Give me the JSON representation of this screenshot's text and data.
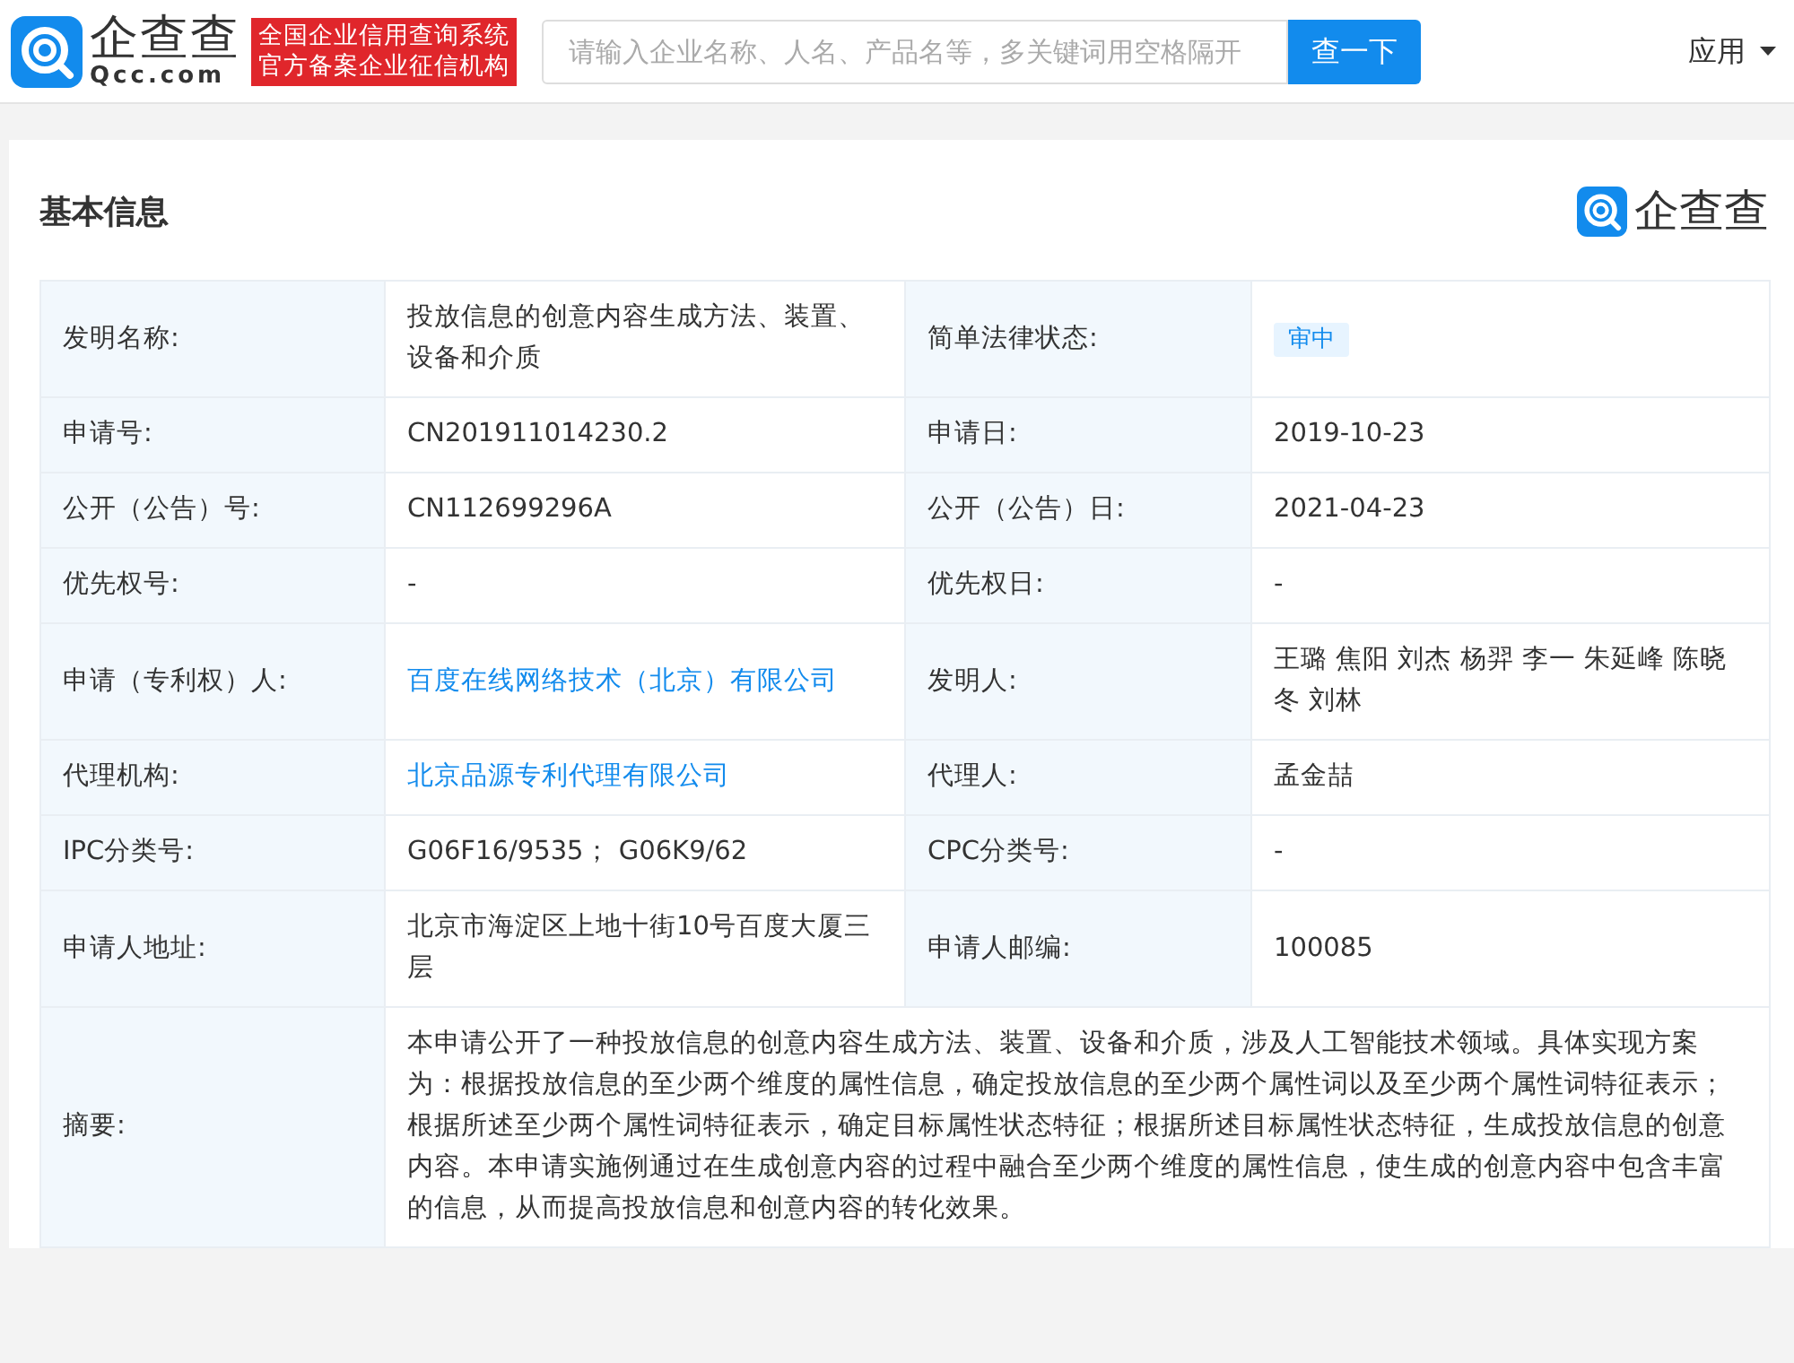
{
  "header": {
    "logo": {
      "name": "企查查",
      "domain": "Qcc.com"
    },
    "slogan": [
      "全国企业信用查询系统",
      "官方备案企业征信机构"
    ],
    "search": {
      "placeholder": "请输入企业名称、人名、产品名等，多关键词用空格隔开"
    },
    "search_button": "查一下",
    "menu": "应用"
  },
  "section": {
    "title": "基本信息",
    "brand": "企查查"
  },
  "rows": [
    {
      "fields": [
        {
          "label": "发明名称:",
          "kind": "text",
          "value": "投放信息的创意内容生成方法、装置、设备和介质"
        },
        {
          "label": "简单法律状态:",
          "kind": "badge",
          "value": "审中"
        }
      ]
    },
    {
      "fields": [
        {
          "label": "申请号:",
          "kind": "text",
          "value": "CN201911014230.2"
        },
        {
          "label": "申请日:",
          "kind": "text",
          "value": "2019-10-23"
        }
      ]
    },
    {
      "fields": [
        {
          "label": "公开（公告）号:",
          "kind": "text",
          "value": "CN112699296A"
        },
        {
          "label": "公开（公告）日:",
          "kind": "text",
          "value": "2021-04-23"
        }
      ]
    },
    {
      "fields": [
        {
          "label": "优先权号:",
          "kind": "text",
          "value": "-"
        },
        {
          "label": "优先权日:",
          "kind": "text",
          "value": "-"
        }
      ]
    },
    {
      "fields": [
        {
          "label": "申请（专利权）人:",
          "kind": "link",
          "value": "百度在线网络技术（北京）有限公司"
        },
        {
          "label": "发明人:",
          "kind": "text",
          "value": "王璐 焦阳 刘杰 杨羿 李一 朱延峰 陈晓冬 刘林"
        }
      ]
    },
    {
      "fields": [
        {
          "label": "代理机构:",
          "kind": "link",
          "value": "北京品源专利代理有限公司"
        },
        {
          "label": "代理人:",
          "kind": "text",
          "value": "孟金喆"
        }
      ]
    },
    {
      "fields": [
        {
          "label": "IPC分类号:",
          "kind": "text",
          "value": "G06F16/9535； G06K9/62"
        },
        {
          "label": "CPC分类号:",
          "kind": "text",
          "value": "-"
        }
      ]
    },
    {
      "fields": [
        {
          "label": "申请人地址:",
          "kind": "text",
          "value": "北京市海淀区上地十街10号百度大厦三层"
        },
        {
          "label": "申请人邮编:",
          "kind": "text",
          "value": "100085"
        }
      ]
    },
    {
      "fields": [
        {
          "label": "摘要:",
          "kind": "text",
          "value": "本申请公开了一种投放信息的创意内容生成方法、装置、设备和介质，涉及人工智能技术领域。具体实现方案为：根据投放信息的至少两个维度的属性信息，确定投放信息的至少两个属性词以及至少两个属性词特征表示；根据所述至少两个属性词特征表示，确定目标属性状态特征；根据所述目标属性状态特征，生成投放信息的创意内容。本申请实施例通过在生成创意内容的过程中融合至少两个维度的属性信息，使生成的创意内容中包含丰富的信息，从而提高投放信息和创意内容的转化效果。"
        }
      ]
    }
  ]
}
